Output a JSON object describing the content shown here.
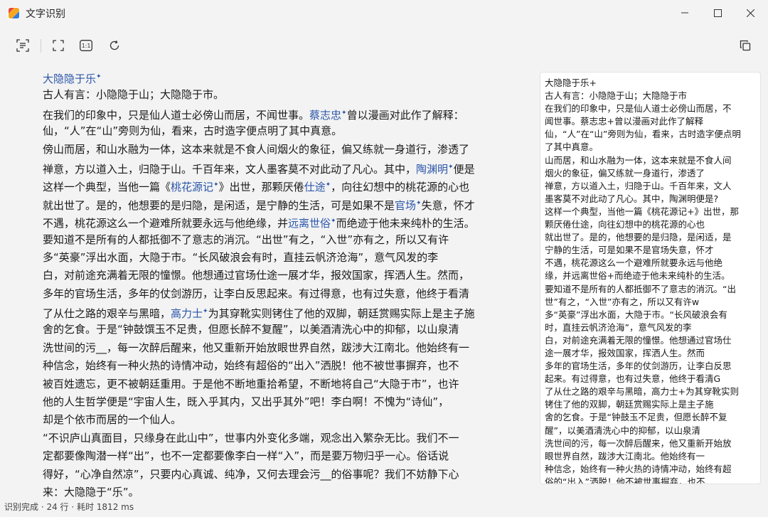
{
  "window": {
    "title": "文字识别",
    "app_icon": "app-icon",
    "min_icon": "minimize-icon",
    "max_icon": "maximize-icon",
    "close_icon": "close-icon"
  },
  "toolbar": {
    "buttons": [
      {
        "name": "text-select-icon"
      },
      {
        "name": "fit-screen-icon"
      },
      {
        "name": "actual-size-icon",
        "label": "1:1"
      },
      {
        "name": "rotate-icon"
      }
    ],
    "copy_icon": "copy-icon"
  },
  "document": {
    "lines": [
      [
        {
          "t": "大隐隐于乐",
          "link": true
        },
        {
          "t": "✦",
          "star": true
        }
      ],
      [
        {
          "t": "古人有言：小隐隐于山；大隐隐于市。"
        }
      ],
      [
        {
          "t": "在我们的印象中，只是仙人道士必傍山而居，不闻世事。"
        },
        {
          "t": "蔡志忠",
          "link": true
        },
        {
          "t": "✦",
          "star": true
        },
        {
          "t": "曾以漫画对此作了解释："
        }
      ],
      [
        {
          "t": "仙，“人”在“山”旁则为仙，看来，古时造字便点明了其中真意。"
        }
      ],
      [
        {
          "t": "傍山而居，和山水融为一体，这本来就是不食人间烟火的象征，偏又练就一身道行，渗透了"
        }
      ],
      [
        {
          "t": "禅意，方以道入土，归隐于山。千百年来，文人墨客莫不对此动了凡心。其中，"
        },
        {
          "t": "陶渊明",
          "link": true
        },
        {
          "t": "✦",
          "star": true
        },
        {
          "t": "便是"
        }
      ],
      [
        {
          "t": "这样一个典型，当他一篇《"
        },
        {
          "t": "桃花源记",
          "link": true
        },
        {
          "t": "✦",
          "star": true
        },
        {
          "t": "》出世，那颗厌倦"
        },
        {
          "t": "仕途",
          "link": true
        },
        {
          "t": "✦",
          "star": true
        },
        {
          "t": "，向往幻想中的桃花源的心也"
        }
      ],
      [
        {
          "t": "就出世了。是的，他想要的是归隐，是闲适，是宁静的生活，可是如果不是"
        },
        {
          "t": "官场",
          "link": true
        },
        {
          "t": "✦",
          "star": true
        },
        {
          "t": "失意，怀才"
        }
      ],
      [
        {
          "t": "不遇，桃花源这么一个避难所就要永远与他绝缘，并"
        },
        {
          "t": "远离世俗",
          "link": true
        },
        {
          "t": "✦",
          "star": true
        },
        {
          "t": "而绝迹于他未来纯朴的生活。"
        }
      ],
      [
        {
          "t": "要知道不是所有的人都抵御不了意志的消沉。“出世”有之，“入世”亦有之，所以又有许"
        }
      ],
      [
        {
          "t": "多“英豪”浮出水面，大隐于市。“长风破浪会有时，直挂云帆济沧海”，意气风发的李"
        }
      ],
      [
        {
          "t": "白，对前途充满着无限的憧憬。他想通过官场仕途一展才华，报效国家，挥洒人生。然而，"
        }
      ],
      [
        {
          "t": "多年的官场生活，多年的仗剑游历，让李白反思起来。有过得意，也有过失意，他终于看清"
        }
      ],
      [
        {
          "t": "了从仕之路的艰辛与黑暗，"
        },
        {
          "t": "高力士",
          "link": true
        },
        {
          "t": "✦",
          "star": true
        },
        {
          "t": "为其穿靴实则铐住了他的双脚，朝廷赏赐实际上是主子施"
        }
      ],
      [
        {
          "t": "舍的乞食。于是“钟鼓馔玉不足贵，但愿长醉不复醒”，以美酒清洗心中的抑郁，以山泉清"
        }
      ],
      [
        {
          "t": "洗世间的污__，每一次醉后醒来，他又重新开始放眼世界自然，跋涉大江南北。他始终有一"
        }
      ],
      [
        {
          "t": "种信念，始终有一种火热的诗情冲动，始终有超俗的“出入”洒脱！他不被世事摒弃，也不"
        }
      ],
      [
        {
          "t": "被百姓遗忘，更不被朝廷重用。于是他不断地重拾希望，不断地将自己“大隐于市”，也许"
        }
      ],
      [
        {
          "t": "他的人生哲学便是“宇宙人生，既入乎其内，又出乎其外”吧！李白啊！不愧为“诗仙”，"
        }
      ],
      [
        {
          "t": "却是个依市而居的一个仙人。"
        }
      ],
      [
        {
          "t": "“不识庐山真面目，只缘身在此山中”，世事内外变化多端，观念出入繁杂无比。我们不一"
        }
      ],
      [
        {
          "t": "定都要像陶潜一样“出”，也不一定都要像李白一样“入”，而是要万物归乎一心。俗话说"
        }
      ],
      [
        {
          "t": "得好，“心净自然凉”，只要内心真诚、纯净，又何去理会污__的俗事呢？我们不妨静下心"
        }
      ],
      [
        {
          "t": "来：大隐隐于“乐”。"
        }
      ]
    ]
  },
  "result": {
    "lines": [
      "大隐隐于乐+",
      "古人有言：小隐隐于山；大隐隐于市",
      "在我们的印象中，只是仙人道士必傍山而居，不",
      "闻世事。蔡志忠+曾以漫画对此作了解释",
      "仙，“人”在“山”旁则为仙，看来，古时造字便点明",
      "了其中真意。",
      "山而居，和山水融为一体，这本来就是不食人间",
      "烟火的象征，偏又练就一身道行，渗透了",
      "禅意，方以道入土，归隐于山。千百年来，文人",
      "墨客莫不对此动了凡心。其中，陶渊明便是?",
      "这样一个典型，当他一篇《桃花源记+》出世，那",
      "颗厌倦仕途，向往幻想中的桃花源的心也",
      "就出世了。是的，他想要的是归隐，是闲适，是",
      "宁静的生活，可是如果不是官场失意，怀才",
      "不遇，桃花源这么一个避难所就要永远与他绝",
      "缘，并远离世俗+而绝迹于他未来纯朴的生活。",
      "要知道不是所有的人都抵御不了意志的消沉。“出",
      "世”有之，“入世”亦有之，所以又有许w",
      "多“英豪”浮出水面，大隐于市。“长风破浪会有",
      "时，直挂云帆济沧海”，意气风发的李",
      "白，对前途充满着无限的憧憬。他想通过官场仕",
      "途一展才华，报效国家，挥洒人生。然而",
      "多年的官场生活，多年的仗剑游历，让李白反思",
      "起来。有过得意，也有过失意，他终于看清G",
      "了从仕之路的艰辛与黑暗，高力士+为其穿靴实则",
      "铐住了他的双脚，朝廷赏赐实际上是主子施",
      "舍的乞食。于是“钟鼓玉不足贵，但愿长醉不复",
      "醒”，以美酒清洗心中的抑郁，以山泉清",
      "洗世间的污，每一次醉后醒来，他又重新开始放",
      "眼世界自然，跋涉大江南北。他始终有一",
      "种信念，始终有一种火热的诗情冲动，始终有超",
      "俗的“出入”洒脱！他不被世事摒弃，也不"
    ]
  },
  "status": {
    "text": "识别完成 · 24 行 · 耗时 1812 ms"
  }
}
